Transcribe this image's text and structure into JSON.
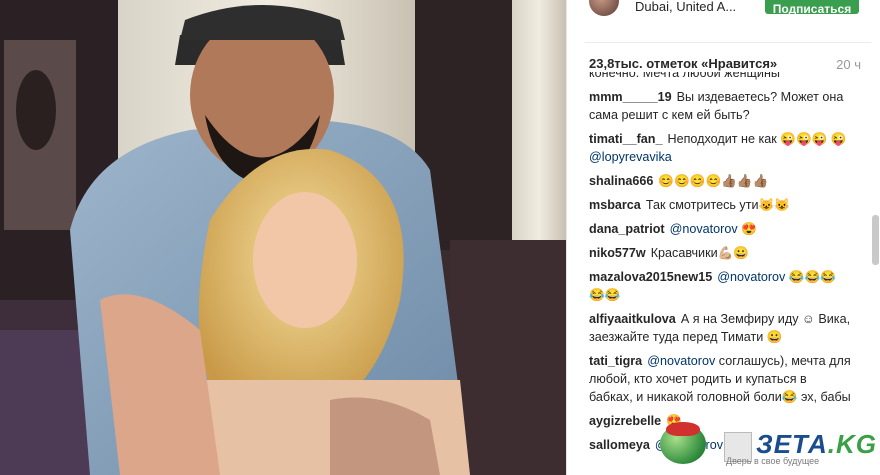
{
  "post": {
    "location": "Dubai, United A...",
    "follow_label": "Подписаться",
    "likes": "23,8тыс. отметок «Нравится»",
    "time": "20 ч"
  },
  "comments": [
    {
      "user": "",
      "text": "конечно. Мечта любой женщины",
      "mention": "",
      "emoji": ""
    },
    {
      "user": "mmm_____19",
      "text": "Вы издеваетесь? Может она сама решит с кем ей быть?",
      "mention": "",
      "emoji": ""
    },
    {
      "user": "timati__fan_",
      "text": "Неподходит не как 😜😜😜 😜",
      "mention": "@lopyrevavika",
      "emoji": ""
    },
    {
      "user": "shalina666",
      "text": "😊😊😊😊👍🏽👍🏽👍🏽",
      "mention": "",
      "emoji": ""
    },
    {
      "user": "msbarca",
      "text": "Так смотритесь ути😺😺",
      "mention": "",
      "emoji": ""
    },
    {
      "user": "dana_patriot",
      "text": "",
      "mention": "@novatorov",
      "emoji": "😍"
    },
    {
      "user": "niko577w",
      "text": "Красавчики💪🏼😀",
      "mention": "",
      "emoji": ""
    },
    {
      "user": "mazalova2015new15",
      "text": "",
      "mention": "@novatorov",
      "emoji": "😂😂😂 😂😂"
    },
    {
      "user": "alfiyaaitkulova",
      "text": "А я на Земфиру иду ☺ Вика, заезжайте туда перед Тимати 😀",
      "mention": "",
      "emoji": ""
    },
    {
      "user": "tati_tigra",
      "text": "соглашусь), мечта для любой, кто хочет родить и купаться в бабках, и никакой головной боли😂 эх, бабы",
      "mention": "@novatorov",
      "emoji": ""
    },
    {
      "user": "aygizrebelle",
      "text": "",
      "mention": "",
      "emoji": "😍"
    },
    {
      "user": "sallomeya",
      "text": "",
      "mention": "@novatorov",
      "emoji": ""
    }
  ],
  "watermark": {
    "brand": "ЗЕТА",
    "brand_suffix": ".KG",
    "tagline": "Дверь в свое будущее"
  },
  "colors": {
    "follow_green": "#3a9e4f",
    "mention_blue": "#003569",
    "text_dark": "#262626",
    "time_gray": "#999999"
  }
}
